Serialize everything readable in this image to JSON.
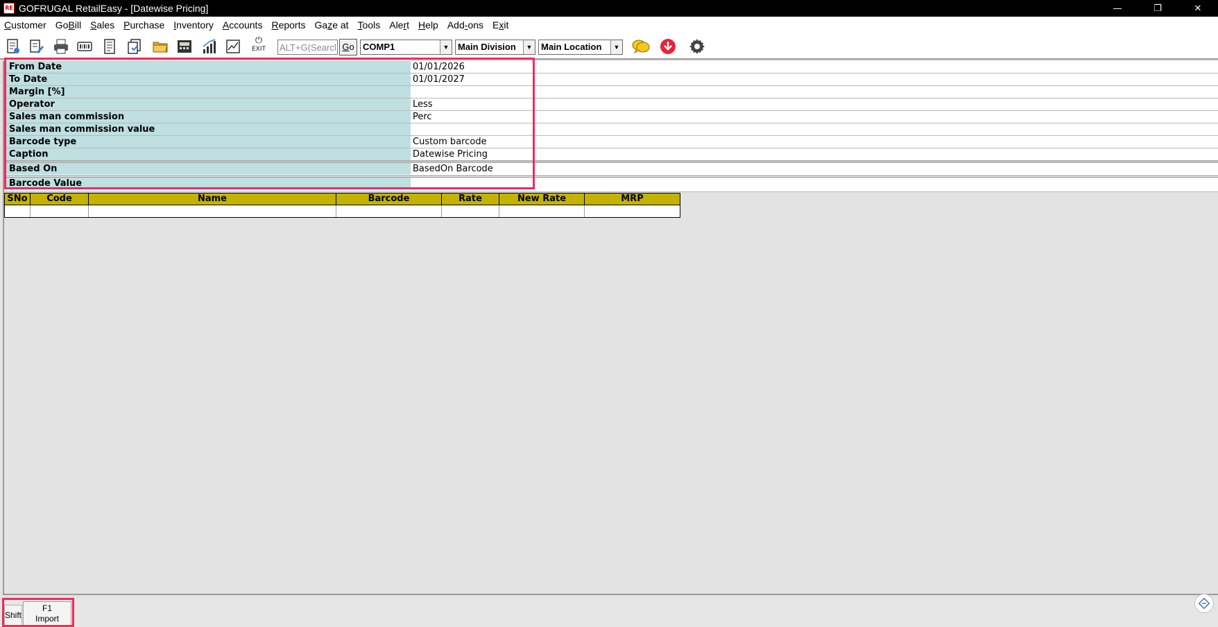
{
  "window": {
    "title": "GOFRUGAL RetailEasy - [Datewise Pricing]",
    "app_icon_text": "RE",
    "minimize_glyph": "—",
    "restore_glyph": "❐",
    "close_glyph": "✕"
  },
  "menu": [
    {
      "pre": "",
      "ul": "C",
      "post": "ustomer"
    },
    {
      "pre": "Go",
      "ul": "B",
      "post": "ill"
    },
    {
      "pre": "",
      "ul": "S",
      "post": "ales"
    },
    {
      "pre": "",
      "ul": "P",
      "post": "urchase"
    },
    {
      "pre": "",
      "ul": "I",
      "post": "nventory"
    },
    {
      "pre": "",
      "ul": "A",
      "post": "ccounts"
    },
    {
      "pre": "",
      "ul": "R",
      "post": "eports"
    },
    {
      "pre": "Ga",
      "ul": "z",
      "post": "e at"
    },
    {
      "pre": "",
      "ul": "T",
      "post": "ools"
    },
    {
      "pre": "Ale",
      "ul": "r",
      "post": "t"
    },
    {
      "pre": "",
      "ul": "H",
      "post": "elp"
    },
    {
      "pre": "Add",
      "ul": "-",
      "post": "ons"
    },
    {
      "pre": "E",
      "ul": "x",
      "post": "it"
    }
  ],
  "toolbar": {
    "exit_label": "EXIT",
    "search_placeholder": "ALT+G(Search)",
    "go_ul": "G",
    "go_rest": "o",
    "company": "COMP1",
    "division": "Main Division",
    "location": "Main Location",
    "combo_arrow": "▼",
    "icons": [
      "bill-icon",
      "edit-document-icon",
      "print-icon",
      "barcode-reader-icon",
      "report-icon",
      "copy-icon",
      "open-folder-icon",
      "calculator-icon",
      "bar-chart-icon",
      "line-chart-icon",
      "chat-icon",
      "download-alert-icon",
      "settings-gear-icon"
    ]
  },
  "form": {
    "rows": [
      {
        "label": "From Date",
        "value": "01/01/2026"
      },
      {
        "label": "To Date",
        "value": "01/01/2027"
      },
      {
        "label": "Margin [%]",
        "value": ""
      },
      {
        "label": "Operator",
        "value": "Less"
      },
      {
        "label": "Sales man commission",
        "value": "Perc"
      },
      {
        "label": "Sales man commission value",
        "value": ""
      },
      {
        "label": "Barcode type",
        "value": "Custom barcode"
      },
      {
        "label": "Caption",
        "value": "Datewise Pricing"
      },
      {
        "label": "Based On",
        "value": "BasedOn Barcode"
      },
      {
        "label": "Barcode Value",
        "value": ""
      }
    ]
  },
  "grid": {
    "columns": [
      "SNo",
      "Code",
      "Name",
      "Barcode",
      "Rate",
      "New Rate",
      "MRP"
    ]
  },
  "function_keys": {
    "shift_label": "Shift",
    "f1_key": "F1",
    "f1_label": "Import"
  },
  "colors": {
    "label_bg": "#bfdfe1",
    "grid_header_bg": "#c3b300",
    "highlight": "#ef2b5f"
  }
}
